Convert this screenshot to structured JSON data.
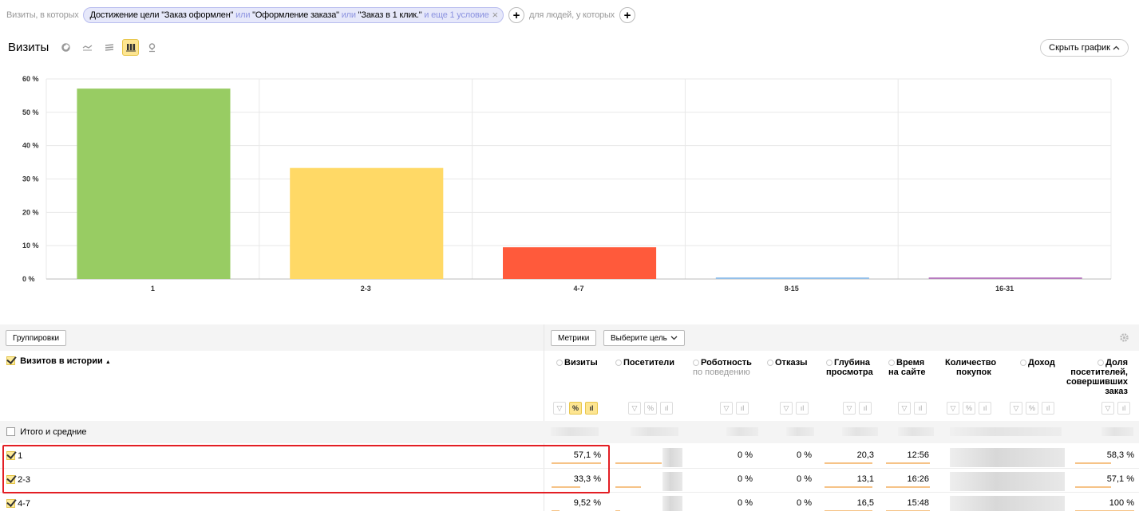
{
  "filter": {
    "prefix": "Визиты, в которых",
    "seg_text_1": "Достижение цели \"Заказ оформлен\"",
    "seg_or_1": "или",
    "seg_text_2": "\"Оформление заказа\"",
    "seg_or_2": "или",
    "seg_text_3": "\"Заказ в 1 клик.\"",
    "seg_more": "и еще 1 условие",
    "people": "для людей, у которых"
  },
  "header": {
    "title": "Визиты",
    "hide_chart": "Скрыть график"
  },
  "chart_data": {
    "type": "bar",
    "categories": [
      "1",
      "2-3",
      "4-7",
      "8-15",
      "16-31"
    ],
    "values": [
      57.1,
      33.3,
      9.52,
      0.05,
      0.05
    ],
    "colors": [
      "#98cc63",
      "#ffd966",
      "#ff5a3b",
      "#93c0ea",
      "#b77bbf"
    ],
    "ylim": [
      0,
      60
    ],
    "yticks": [
      0,
      10,
      20,
      30,
      40,
      50,
      60
    ],
    "ytick_labels": [
      "0 %",
      "10 %",
      "20 %",
      "30 %",
      "40 %",
      "50 %",
      "60 %"
    ],
    "grid": true
  },
  "table": {
    "groupings_btn": "Группировки",
    "metrics_btn": "Метрики",
    "goal_btn": "Выберите цель",
    "dimension": "Визитов в истории",
    "columns": {
      "visits": "Визиты",
      "visitors": "Посетители",
      "robot": "Роботность",
      "robot_sub": "по поведению",
      "bounce": "Отказы",
      "depth_1": "Глубина",
      "depth_2": "просмотра",
      "time_1": "Время",
      "time_2": "на сайте",
      "purch_1": "Количество",
      "purch_2": "покупок",
      "revenue": "Доход",
      "share_1": "Доля",
      "share_2": "посетителей,",
      "share_3": "совершивших",
      "share_4": "заказ"
    },
    "totals_label": "Итого и средние",
    "rows": [
      {
        "label": "1",
        "visits": "57,1 %",
        "robot": "0 %",
        "bounce": "0 %",
        "depth": "20,3",
        "time": "12:56",
        "share": "58,3 %",
        "visits_frac": 0.571
      },
      {
        "label": "2-3",
        "visits": "33,3 %",
        "robot": "0 %",
        "bounce": "0 %",
        "depth": "13,1",
        "time": "16:26",
        "share": "57,1 %",
        "visits_frac": 0.333
      },
      {
        "label": "4-7",
        "visits": "9,52 %",
        "robot": "0 %",
        "bounce": "0 %",
        "depth": "16,5",
        "time": "15:48",
        "share": "100 %",
        "visits_frac": 0.0952
      }
    ]
  }
}
